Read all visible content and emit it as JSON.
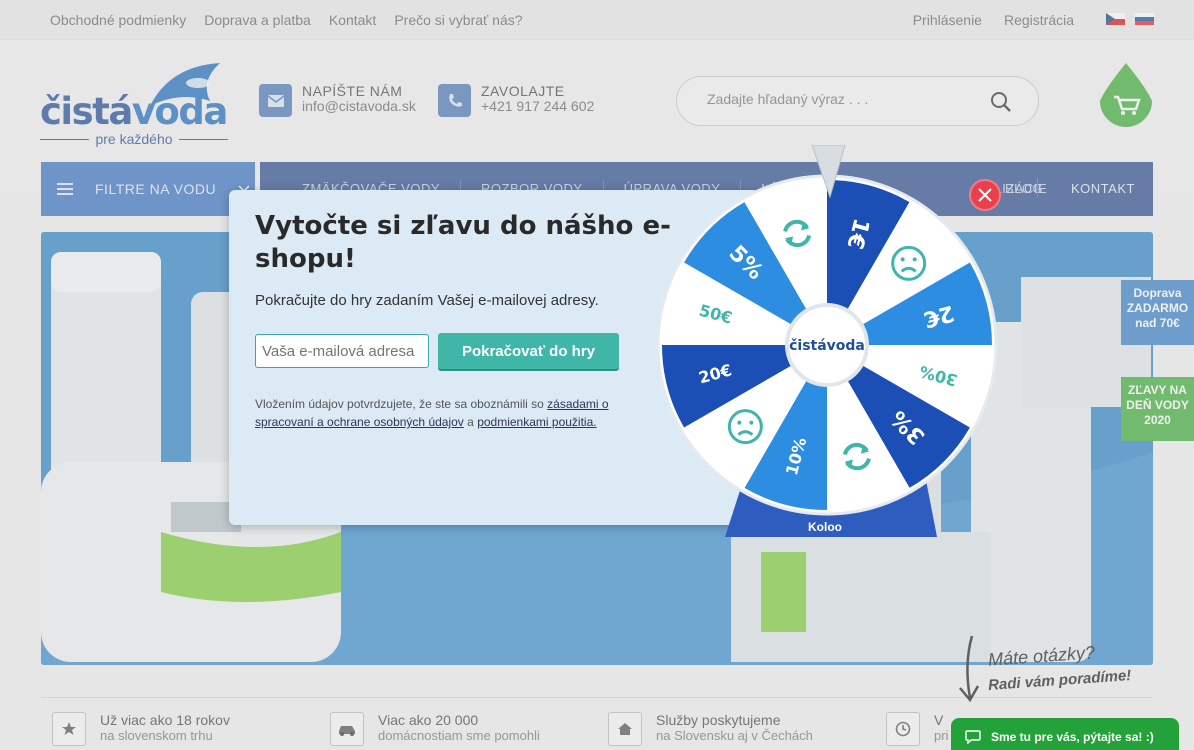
{
  "topbar": {
    "links": [
      "Obchodné podmienky",
      "Doprava a platba",
      "Kontakt",
      "Prečo si vybrať nás?"
    ],
    "login": "Prihlásenie",
    "register": "Registrácia"
  },
  "logo": {
    "main_a": "čistá",
    "main_b": "voda",
    "sub": "pre každého"
  },
  "contact": {
    "email_label": "NAPÍŠTE NÁM",
    "email_value": "info@cistavoda.sk",
    "phone_label": "ZAVOLAJTE",
    "phone_value": "+421 917 244 602"
  },
  "search": {
    "placeholder": "Zadajte hľadaný výraz . . ."
  },
  "nav": {
    "menu_label": "FILTRE NA VODU",
    "items": [
      "ZMÄKČOVAČE VODY",
      "ROZBOR VODY",
      "ÚPRAVA VODY",
      "LÁTKY",
      "...ALIZÁCIE",
      "BLOG",
      "KONTAKT"
    ]
  },
  "badges": {
    "shipping": "Doprava ZADARMO nad 70€",
    "sale": "ZĽAVY NA DEŇ VODY 2020"
  },
  "modal": {
    "title": "Vytočte si zľavu do nášho e-shopu!",
    "subtitle": "Pokračujte do hry zadaním Vašej e-mailovej adresy.",
    "email_placeholder": "Vaša e-mailová adresa",
    "button": "Pokračovať do hry",
    "legal_pre": "Vložením údajov potvrdzujete, že ste sa oboznámili so",
    "legal_link1": "zásadami o spracovaní a ochrane osobných údajov",
    "legal_mid": "a",
    "legal_link2": "podmienkami použitia."
  },
  "wheel": {
    "segments": [
      "1€",
      "sad",
      "2€",
      "30%",
      "3%",
      "retry",
      "10%",
      "sad",
      "20€",
      "50€",
      "5%",
      "retry"
    ],
    "center_logo": "čistávoda",
    "brand": "Koloo"
  },
  "features": [
    {
      "t1": "Už viac ako 18 rokov",
      "t2": "na slovenskom trhu",
      "icon": "star-icon"
    },
    {
      "t1": "Viac ako 20 000",
      "t2": "domácnostiam sme pomohli",
      "icon": "car-icon"
    },
    {
      "t1": "Služby poskytujeme",
      "t2": "na Slovensku aj v Čechách",
      "icon": "home-icon"
    },
    {
      "t1": "V",
      "t2": "pri",
      "icon": "clock-icon"
    }
  ],
  "questions": {
    "line1": "Máte otázky?",
    "line2": "Radi vám poradíme!"
  },
  "chat": {
    "label": "Sme tu pre vás, pýtajte sa! :)"
  },
  "colors": {
    "primary": "#2d4d8f",
    "accent": "#3fb6a8",
    "green": "#3fae3a",
    "close": "#e8414d"
  }
}
